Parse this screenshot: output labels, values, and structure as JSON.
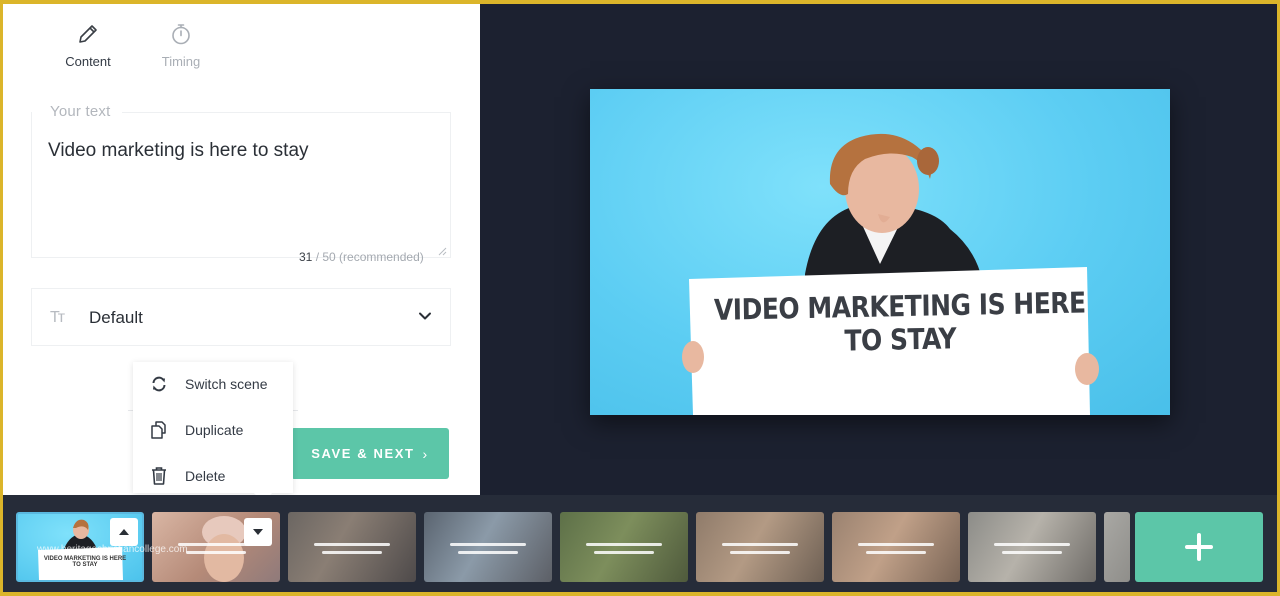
{
  "tabs": {
    "content": "Content",
    "timing": "Timing"
  },
  "editor": {
    "field_label": "Your text",
    "text_value": "Video marketing is here to stay",
    "count_current": "31",
    "count_suffix": "/ 50 (recommended)",
    "font_icon": "Tт",
    "font_value": "Default"
  },
  "save_button": {
    "label": "SAVE & NEXT",
    "chevron": "›"
  },
  "context_menu": {
    "items": [
      {
        "label": "Switch scene",
        "icon": "refresh-icon"
      },
      {
        "label": "Duplicate",
        "icon": "duplicate-icon"
      },
      {
        "label": "Delete",
        "icon": "trash-icon"
      }
    ]
  },
  "preview": {
    "sign_text": "VIDEO MARKETING IS HERE TO STAY"
  },
  "timeline": {
    "thumb1_caption": "VIDEO MARKETING IS HERE TO STAY",
    "watermark": "www.heritagechristiancollege.com",
    "add_icon": "plus-icon"
  },
  "colors": {
    "accent": "#5cc6a8",
    "dark_bg": "#1c2130",
    "timeline_bg": "#262c39",
    "preview_bg": "#5ccdf3"
  }
}
